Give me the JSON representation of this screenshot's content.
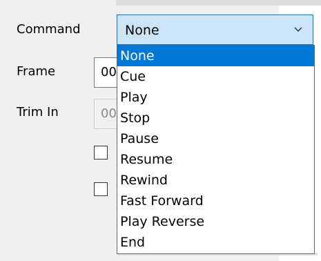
{
  "form": {
    "command_label": "Command",
    "frame_label": "Frame",
    "trim_in_label": "Trim In",
    "frame_value": "00",
    "trim_in_value": "00"
  },
  "combo": {
    "value": "None",
    "icon": "chevron-down-icon"
  },
  "dropdown": {
    "options": [
      "None",
      "Cue",
      "Play",
      "Stop",
      "Pause",
      "Resume",
      "Rewind",
      "Fast Forward",
      "Play Reverse",
      "End"
    ],
    "selected_index": 0
  },
  "colors": {
    "accent": "#0078d7",
    "combo_background": "#cce4f7",
    "panel_background": "#f0f0f0"
  }
}
